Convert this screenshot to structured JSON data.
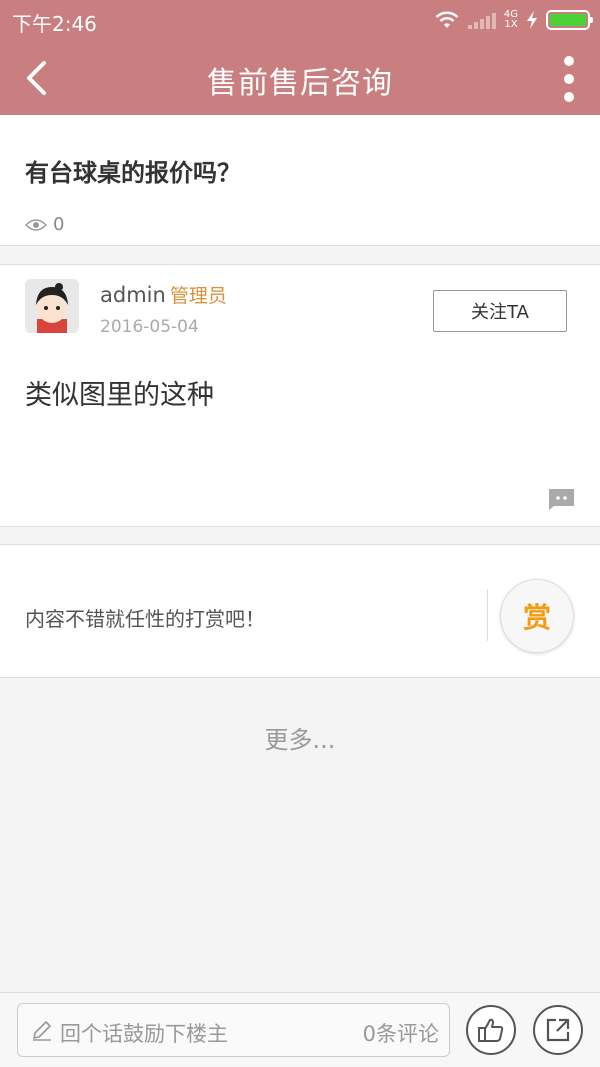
{
  "status_bar": {
    "time": "下午2:46",
    "network_top": "4G",
    "network_bottom": "1X",
    "battery_level": 1.0,
    "battery_color": "#4cd137"
  },
  "app_bar": {
    "title": "售前售后咨询",
    "back_icon": "chevron-left-icon",
    "more_icon": "more-vertical-icon",
    "background": "#c97f7f"
  },
  "question": {
    "title": "有台球桌的报价吗？",
    "view_icon": "eye-icon",
    "views": "0"
  },
  "post": {
    "username": "admin",
    "role": "管理员",
    "date": "2016-05-04",
    "follow_label": "关注TA",
    "body": "类似图里的这种",
    "comment_icon": "comment-bubble-icon"
  },
  "reward": {
    "text": "内容不错就任性的打赏吧！",
    "button_label": "赏"
  },
  "more_label": "更多...",
  "bottom_bar": {
    "placeholder": "回个话鼓励下楼主",
    "comment_count": "0条评论",
    "like_icon": "thumbs-up-icon",
    "share_icon": "share-icon"
  }
}
